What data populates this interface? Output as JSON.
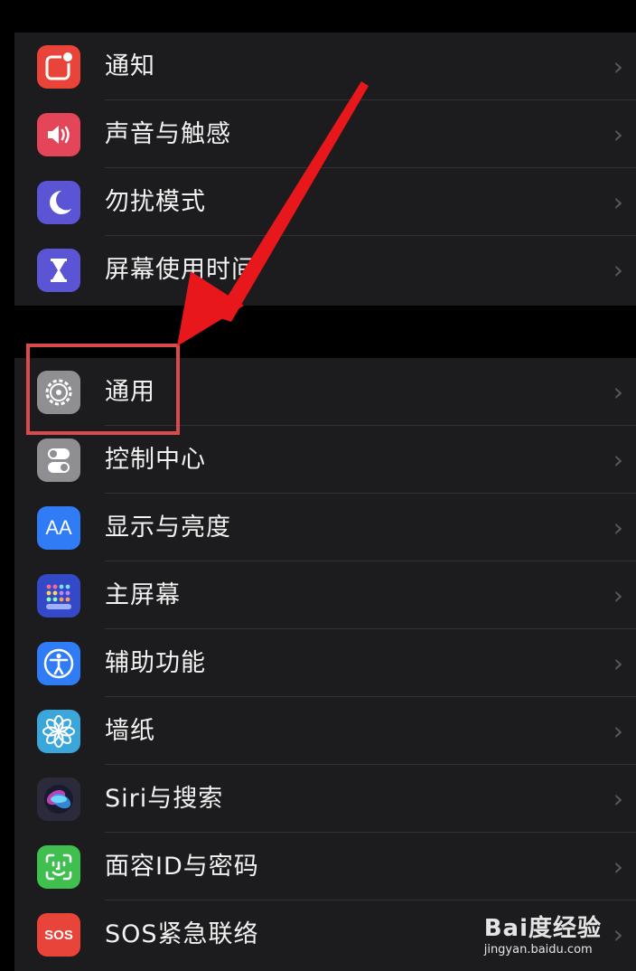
{
  "group1": [
    {
      "label": "通知",
      "icon": "notifications-icon",
      "color": "#e8443a"
    },
    {
      "label": "声音与触感",
      "icon": "sound-icon",
      "color": "#e44558"
    },
    {
      "label": "勿扰模式",
      "icon": "moon-icon",
      "color": "#5b55d6"
    },
    {
      "label": "屏幕使用时间",
      "icon": "hourglass-icon",
      "color": "#5b55d6"
    }
  ],
  "group2": [
    {
      "label": "通用",
      "icon": "gear-icon",
      "color": "#8e8e93"
    },
    {
      "label": "控制中心",
      "icon": "toggles-icon",
      "color": "#8e8e93"
    },
    {
      "label": "显示与亮度",
      "icon": "aa-icon",
      "color": "#2f7cf6",
      "glyph": "AA"
    },
    {
      "label": "主屏幕",
      "icon": "home-screen-icon",
      "color": "#3449c8"
    },
    {
      "label": "辅助功能",
      "icon": "accessibility-icon",
      "color": "#2f7cf6"
    },
    {
      "label": "墙纸",
      "icon": "flower-icon",
      "color": "#3aa6d9"
    },
    {
      "label": "Siri与搜索",
      "icon": "siri-icon",
      "color": "#2a2a3a"
    },
    {
      "label": "面容ID与密码",
      "icon": "faceid-icon",
      "color": "#3fbf4f"
    },
    {
      "label": "SOS紧急联络",
      "icon": "sos-icon",
      "color": "#e8443a",
      "glyph": "SOS"
    }
  ],
  "chevron": "›",
  "watermark": {
    "brand": "Bai度经验",
    "url": "jingyan.baidu.com"
  },
  "annotation_color": "#d84a4c"
}
